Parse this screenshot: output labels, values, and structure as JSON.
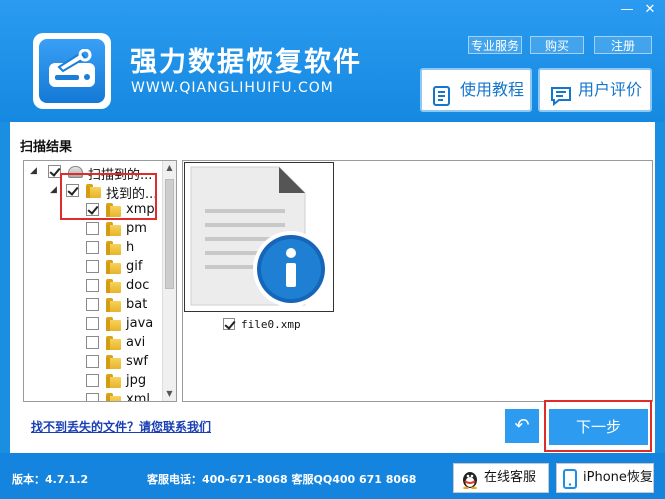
{
  "window": {
    "minimize_glyph": "—",
    "close_glyph": "✕"
  },
  "header": {
    "title": "强力数据恢复软件",
    "url": "WWW.QIANGLIHUIFU.COM",
    "links": [
      "专业服务",
      "购买",
      "注册"
    ],
    "tutorial_label": "使用教程",
    "review_label": "用户评价",
    "logo_icon": "hard-drive-wrench-icon"
  },
  "main": {
    "scan_label": "扫描结果",
    "tree": {
      "root_label": "扫描到的...",
      "found_label": "找到的...",
      "items": [
        "xmp",
        "pm",
        "h",
        "gif",
        "doc",
        "bat",
        "java",
        "avi",
        "swf",
        "jpg",
        "xml"
      ],
      "checked": [
        "xmp"
      ]
    },
    "preview": {
      "file_name": "file0.xmp",
      "file_icon": "document-info-icon"
    },
    "contact_link": "找不到丢失的文件？请您联系我们",
    "back_glyph": "↶",
    "next_label": "下一步"
  },
  "footer": {
    "version": "版本：4.7.1.2",
    "hotline": "客服电话：400-671-8068 客服QQ400 671 8068",
    "online_service_label": "在线客服",
    "iphone_label": "iPhone恢复"
  },
  "colors": {
    "brand_blue": "#1a8ee0",
    "button_blue": "#2d9cf0",
    "highlight_red": "#e02b2b"
  }
}
